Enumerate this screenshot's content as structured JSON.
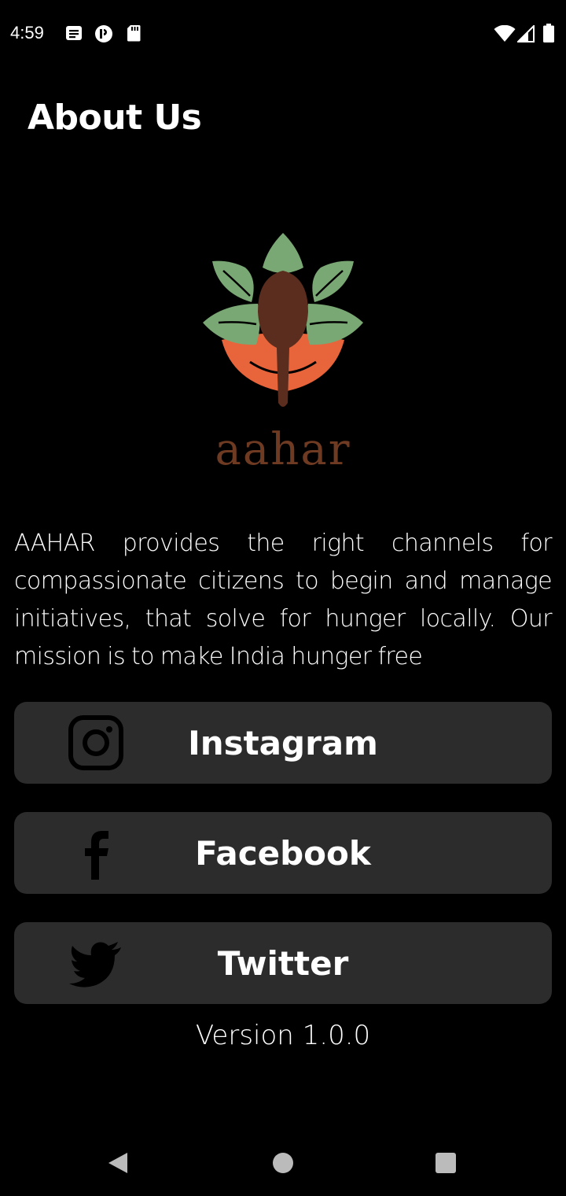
{
  "status_bar": {
    "time": "4:59",
    "left_icons": [
      "notes-icon",
      "podcast-icon",
      "sd-card-icon"
    ],
    "right_icons": [
      "wifi-icon",
      "cell-signal-icon",
      "battery-icon"
    ]
  },
  "header": {
    "title": "About Us"
  },
  "logo": {
    "wordmark": "aahar",
    "colors": {
      "leaf": "#7aa874",
      "spoon": "#5a2d1e",
      "bowl": "#e8643a",
      "wordmark": "#6e3a22"
    }
  },
  "about": {
    "text": "AAHAR provides the right channels for compassionate citizens to begin and manage initiatives, that solve for hunger locally. Our mission is to make India hunger free"
  },
  "social_links": {
    "instagram": {
      "label": "Instagram",
      "icon": "instagram-icon"
    },
    "facebook": {
      "label": "Facebook",
      "icon": "facebook-icon"
    },
    "twitter": {
      "label": "Twitter",
      "icon": "twitter-icon"
    }
  },
  "footer": {
    "version": "Version 1.0.0"
  },
  "nav_bar": {
    "icons": [
      "back-icon",
      "home-icon",
      "recents-icon"
    ]
  },
  "theme": {
    "background": "#000000",
    "button_background": "#2c2c2c",
    "text": "#ffffff"
  }
}
